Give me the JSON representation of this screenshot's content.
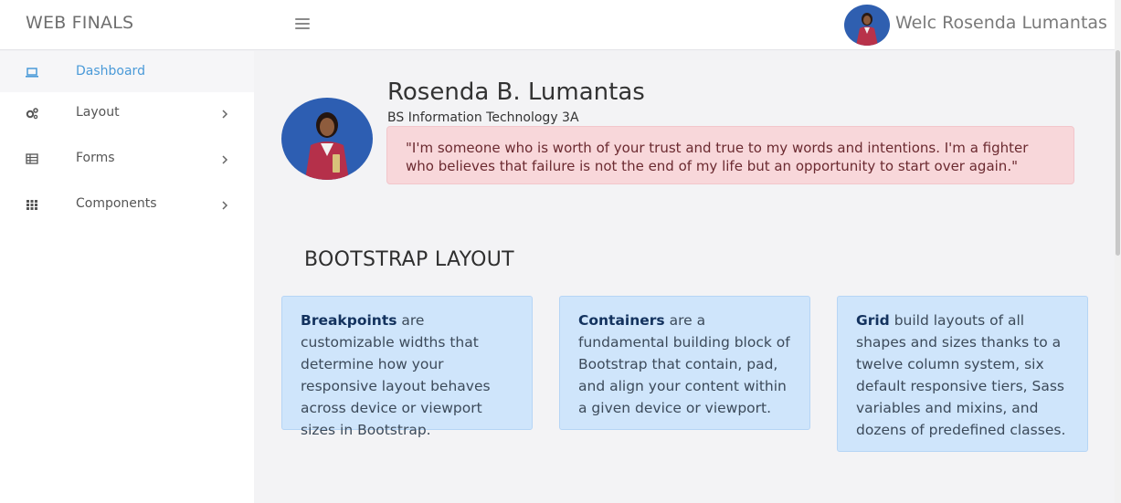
{
  "header": {
    "brand": "WEB FINALS",
    "welcome": "Welc Rosenda Lumantas"
  },
  "sidebar": {
    "items": [
      {
        "label": "Dashboard",
        "icon": "laptop-icon",
        "active": true
      },
      {
        "label": "Layout",
        "icon": "gears-icon"
      },
      {
        "label": "Forms",
        "icon": "table-icon"
      },
      {
        "label": "Components",
        "icon": "grid-icon"
      }
    ]
  },
  "profile": {
    "name": "Rosenda B. Lumantas",
    "course": "BS Information Technology 3A",
    "quote": "\"I'm someone who is worth of your trust and true to my words and intentions. I'm a fighter who believes that failure is not the end of my life but an opportunity to start over again.\""
  },
  "section": {
    "title": "BOOTSTRAP LAYOUT"
  },
  "cards": [
    {
      "term": "Breakpoints",
      "text": " are customizable widths that determine how your responsive layout behaves across device or viewport sizes in Bootstrap."
    },
    {
      "term": "Containers",
      "text": " are a fundamental building block of Bootstrap that contain, pad, and align your content within a given device or viewport."
    },
    {
      "term": "Grid",
      "text": " build layouts of all shapes and sizes thanks to a twelve column system, six default responsive tiers, Sass variables and mixins, and dozens of predefined classes."
    }
  ],
  "colors": {
    "accent": "#4a9ad8",
    "quote_bg": "#f8d7da",
    "card_bg": "#cfe5fb"
  }
}
